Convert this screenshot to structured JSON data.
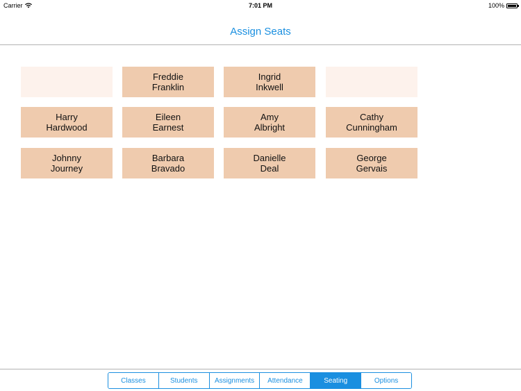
{
  "status_bar": {
    "carrier": "Carrier",
    "time": "7:01 PM",
    "battery": "100%"
  },
  "nav": {
    "title": "Assign Seats"
  },
  "seats": [
    {
      "first": "",
      "last": "",
      "empty": true
    },
    {
      "first": "Freddie",
      "last": "Franklin",
      "empty": false
    },
    {
      "first": "Ingrid",
      "last": "Inkwell",
      "empty": false
    },
    {
      "first": "",
      "last": "",
      "empty": true
    },
    {
      "first": "Harry",
      "last": "Hardwood",
      "empty": false
    },
    {
      "first": "Eileen",
      "last": "Earnest",
      "empty": false
    },
    {
      "first": "Amy",
      "last": "Albright",
      "empty": false
    },
    {
      "first": "Cathy",
      "last": "Cunningham",
      "empty": false
    },
    {
      "first": "Johnny",
      "last": "Journey",
      "empty": false
    },
    {
      "first": "Barbara",
      "last": "Bravado",
      "empty": false
    },
    {
      "first": "Danielle",
      "last": "Deal",
      "empty": false
    },
    {
      "first": "George",
      "last": "Gervais",
      "empty": false
    }
  ],
  "tabs": [
    {
      "label": "Classes",
      "selected": false
    },
    {
      "label": "Students",
      "selected": false
    },
    {
      "label": "Assignments",
      "selected": false
    },
    {
      "label": "Attendance",
      "selected": false
    },
    {
      "label": "Seating",
      "selected": true
    },
    {
      "label": "Options",
      "selected": false
    }
  ]
}
